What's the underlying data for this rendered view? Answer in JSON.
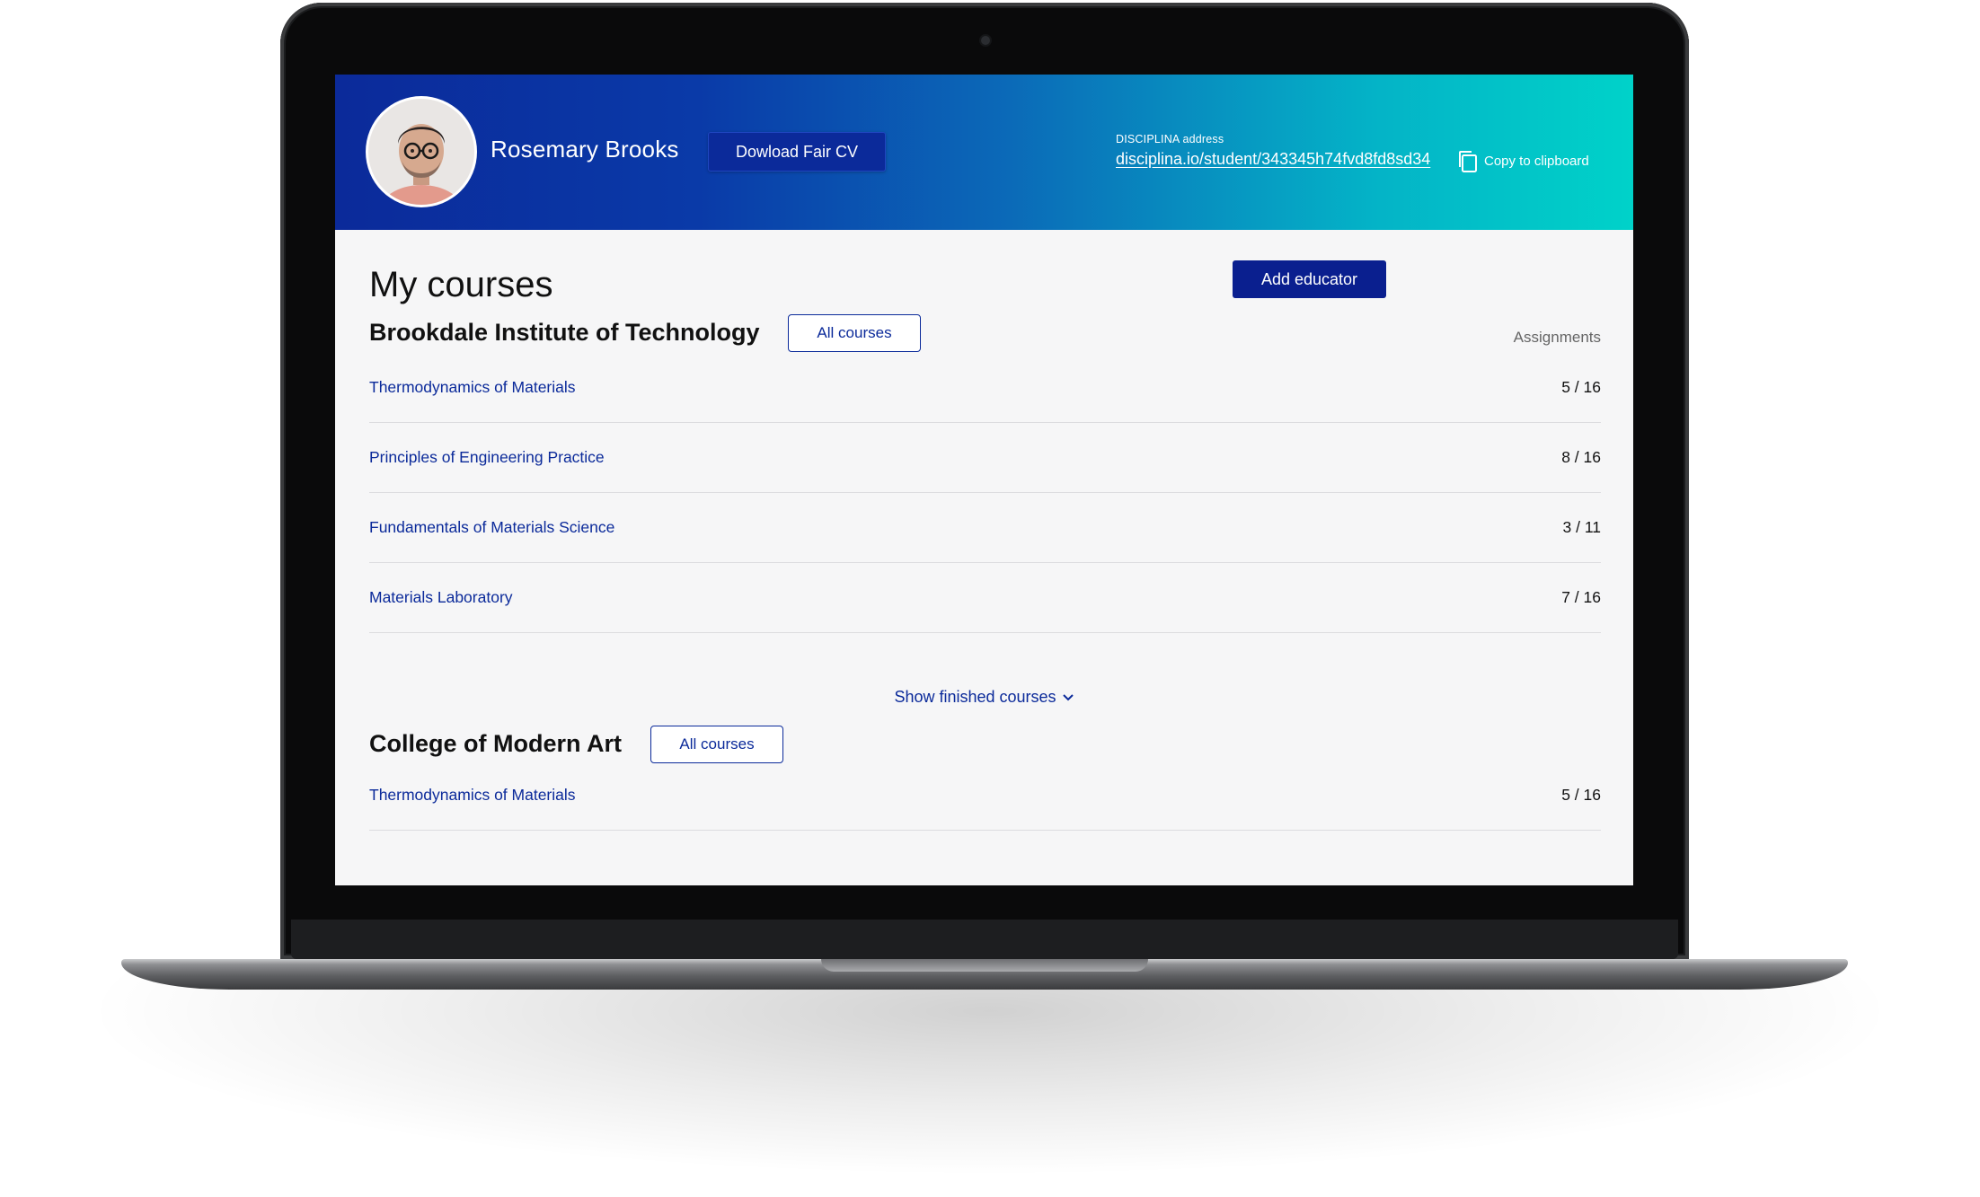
{
  "header": {
    "user_name": "Rosemary Brooks",
    "download_button": "Dowload Fair CV",
    "address_label": "DISCIPLINA address",
    "address_link": "disciplina.io/student/343345h74fvd8fd8sd34",
    "copy_label": "Copy to clipboard"
  },
  "main": {
    "title": "My courses",
    "add_educator_button": "Add educator",
    "institutions": [
      {
        "name": "Brookdale Institute of Technology",
        "all_courses_button": "All courses",
        "column_header": "Assignments",
        "courses": [
          {
            "name": "Thermodynamics of Materials",
            "assignments": "5 / 16"
          },
          {
            "name": "Principles of Engineering Practice",
            "assignments": "8 / 16"
          },
          {
            "name": "Fundamentals of Materials Science",
            "assignments": "3 / 11"
          },
          {
            "name": "Materials Laboratory",
            "assignments": "7 / 16"
          }
        ],
        "show_finished": "Show finished courses"
      },
      {
        "name": "College of Modern Art",
        "all_courses_button": "All courses",
        "courses": [
          {
            "name": "Thermodynamics of Materials",
            "assignments": "5 / 16"
          }
        ]
      }
    ]
  },
  "icons": {
    "copy": "copy-icon",
    "chevron": "chevron-down-icon",
    "avatar": "user-avatar-photo"
  },
  "colors": {
    "header_gradient_start": "#0b2a9a",
    "header_gradient_end": "#00d2c9",
    "primary_button": "#0a1f8f",
    "link": "#0b2a9a"
  }
}
